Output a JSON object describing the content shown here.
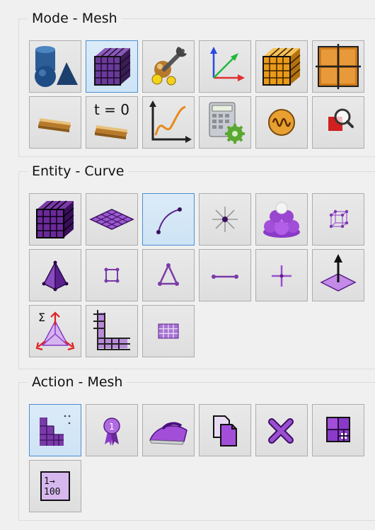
{
  "groups": {
    "mode": {
      "title": "Mode - Mesh",
      "buttons": [
        {
          "name": "geometry",
          "icon": "geometry-shapes-icon"
        },
        {
          "name": "mesh",
          "icon": "mesh-cube-icon",
          "active": true
        },
        {
          "name": "boundary-conditions",
          "icon": "wrench-bc-icon"
        },
        {
          "name": "coordinate-systems",
          "icon": "xyz-axes-icon"
        },
        {
          "name": "material-blocks",
          "icon": "material-cube-icon"
        },
        {
          "name": "groups",
          "icon": "grid-frame-icon"
        },
        {
          "name": "analysis",
          "icon": "layer-plate-icon"
        },
        {
          "name": "initial-conditions",
          "icon": "time-zero-icon",
          "text": "t = 0"
        },
        {
          "name": "plot",
          "icon": "graph-curve-icon"
        },
        {
          "name": "calculator",
          "icon": "calculator-gear-icon"
        },
        {
          "name": "vibration",
          "icon": "wave-circle-icon"
        },
        {
          "name": "inspect",
          "icon": "magnifier-icon"
        }
      ]
    },
    "entity": {
      "title": "Entity - Curve",
      "buttons": [
        {
          "name": "volume",
          "icon": "volume-cube-icon"
        },
        {
          "name": "surface",
          "icon": "surface-plate-icon"
        },
        {
          "name": "curve",
          "icon": "curve-icon",
          "active": true
        },
        {
          "name": "node",
          "icon": "vertex-star-icon"
        },
        {
          "name": "group",
          "icon": "group-spheres-icon"
        },
        {
          "name": "hex",
          "icon": "hex-element-icon"
        },
        {
          "name": "tet",
          "icon": "tet-element-icon"
        },
        {
          "name": "face",
          "icon": "quad-face-icon"
        },
        {
          "name": "tri",
          "icon": "tri-face-icon"
        },
        {
          "name": "edge",
          "icon": "edge-line-icon"
        },
        {
          "name": "node-point",
          "icon": "node-cross-icon"
        },
        {
          "name": "sideset",
          "icon": "sideset-arrow-icon"
        },
        {
          "name": "nodeset",
          "icon": "sigma-tri-icon"
        },
        {
          "name": "block",
          "icon": "block-grid-icon"
        },
        {
          "name": "mesh-grid",
          "icon": "grid-icon"
        }
      ]
    },
    "action": {
      "title": "Action - Mesh",
      "buttons": [
        {
          "name": "mesh-action",
          "icon": "mesh-stairs-icon",
          "active": true
        },
        {
          "name": "quality",
          "icon": "ribbon-award-icon"
        },
        {
          "name": "smooth",
          "icon": "iron-icon"
        },
        {
          "name": "copy",
          "icon": "copy-pages-icon"
        },
        {
          "name": "delete",
          "icon": "delete-x-icon"
        },
        {
          "name": "refine",
          "icon": "refine-squares-icon"
        },
        {
          "name": "renumber",
          "icon": "renumber-icon",
          "text": "1→100"
        }
      ]
    }
  },
  "colors": {
    "purple": "#9b4fd0",
    "purple_dark": "#5a1f87",
    "purple_light": "#c9a6ec",
    "active_bg": "#cde3f5",
    "active_border": "#4a8fd0",
    "button_bg": "#e3e3e3",
    "button_border": "#adadad"
  }
}
